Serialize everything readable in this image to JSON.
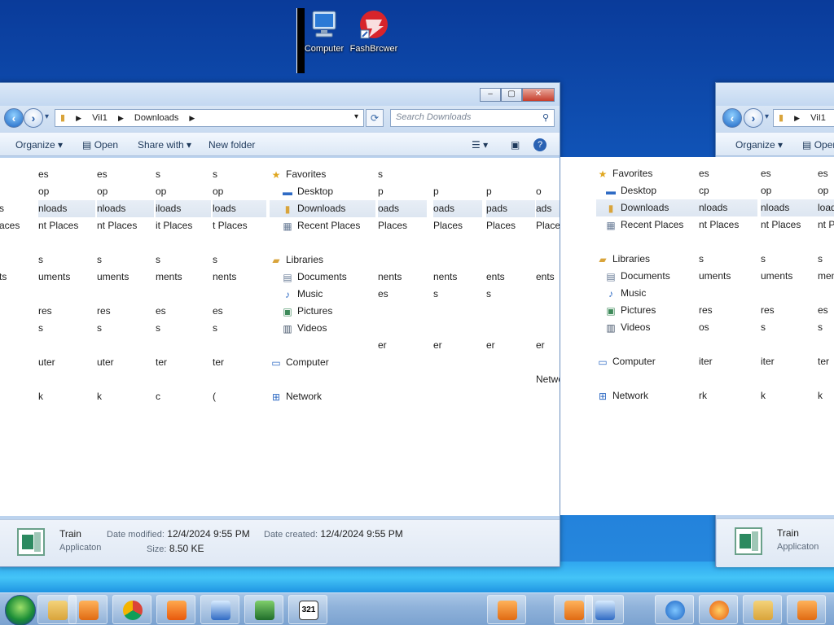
{
  "desktop": {
    "icons": [
      {
        "label": "Computer",
        "icon": "computer-icon"
      },
      {
        "label": "FashBrcwer",
        "icon": "flash-browser-icon"
      }
    ]
  },
  "window_left": {
    "caption_buttons": {
      "minimize": "–",
      "maximize": "▢",
      "close": "✕"
    },
    "nav": {
      "back": "‹",
      "forward": "›",
      "recent": "▾"
    },
    "breadcrumb": [
      "ViI1",
      "Downloads"
    ],
    "address_dropdown": "▾",
    "refresh": "⟳",
    "search_placeholder": "Search Downloads",
    "toolbar": {
      "organize": "Organize",
      "open": "Open",
      "share_with": "Share with",
      "new_folder": "New folder",
      "view_icon": "view-options-icon",
      "help": "?"
    },
    "nav_pane": {
      "favorites": "Favorites",
      "desktop": "Desktop",
      "downloads": "Downloads",
      "recent_places": "Recent Places",
      "libraries": "Libraries",
      "documents": "Documents",
      "music": "Music",
      "pictures": "Pictures",
      "videos": "Videos",
      "computer": "Computer",
      "network": "Network"
    },
    "ghost_columns": [
      [
        "es",
        "op",
        "nloads",
        "nt Places",
        "s",
        "uments",
        "res",
        "s",
        "uter",
        "k"
      ],
      [
        "es",
        "op",
        "nloads",
        "nt Places",
        "s",
        "uments",
        "res",
        "s",
        "uter",
        "k"
      ],
      [
        "s",
        "op",
        "iloads",
        "it Places",
        "s",
        "ments",
        "es",
        "s",
        "ter",
        "c"
      ],
      [
        "s",
        "op",
        "loads",
        "t Places",
        "s",
        "nents",
        "es",
        "s",
        "ter",
        "("
      ]
    ],
    "left_edge": [
      "",
      "",
      "s",
      "aces",
      "",
      "ts",
      "",
      "",
      "",
      ""
    ],
    "ghost_right": [
      [
        "s",
        "p",
        "oads",
        "Places",
        "",
        "nents",
        "es",
        "",
        "er",
        ""
      ],
      [
        "",
        "p",
        "oads",
        "Places",
        "",
        "nents",
        "s",
        "",
        "er",
        ""
      ],
      [
        "",
        "p",
        "pads",
        "Places",
        "",
        "ents",
        "s",
        "",
        "er",
        ""
      ],
      [
        "",
        "o",
        "ads",
        "Places",
        "",
        "ents",
        "",
        "",
        "er",
        "Netwo"
      ]
    ],
    "details": {
      "name": "Train",
      "type": "Applicaton",
      "modified_label": "Date modified:",
      "modified_value": "12/4/2024 9:55 PM",
      "size_label": "Size:",
      "size_value": "8.50 KE",
      "created_label": "Date created:",
      "created_value": "12/4/2024 9:55 PM"
    }
  },
  "window_right": {
    "breadcrumb": [
      "ViI1"
    ],
    "toolbar": {
      "organize": "Organize",
      "open": "Open"
    },
    "nav_pane": {
      "favorites": "Favorites",
      "desktop": "Desktop",
      "downloads": "Downloads",
      "recent_places": "Recent Places",
      "libraries": "Libraries",
      "documents": "Documents",
      "music": "Music",
      "pictures": "Pictures",
      "videos": "Videos",
      "computer": "Computer",
      "network": "Network"
    },
    "ghost_columns": [
      [
        "es",
        "cp",
        "nloads",
        "nt Places",
        "s",
        "uments",
        "res",
        "os",
        "iter",
        "rk"
      ],
      [
        "es",
        "op",
        "nloads",
        "nt Places",
        "s",
        "uments",
        "res",
        "s",
        "iter",
        "k"
      ],
      [
        "es",
        "op",
        "loads",
        "nt Pl",
        "s",
        "men",
        "es",
        "s",
        "ter",
        "k"
      ]
    ],
    "details": {
      "name": "Train",
      "type": "Applicaton"
    }
  },
  "taskbar": {
    "items": [
      "start-orb-icon",
      "explorer-icon",
      "media-player-icon",
      "chrome-icon",
      "firefox-icon",
      "transfer-icon",
      "task-manager-icon",
      "calendar-icon",
      "media-player-icon",
      "chrome-icon",
      "media-player-icon",
      "transfer-icon",
      "chrome-icon",
      "internet-explorer-icon",
      "firefox-icon",
      "explorer-icon",
      "media-player-icon"
    ],
    "calendar_day": "321"
  }
}
